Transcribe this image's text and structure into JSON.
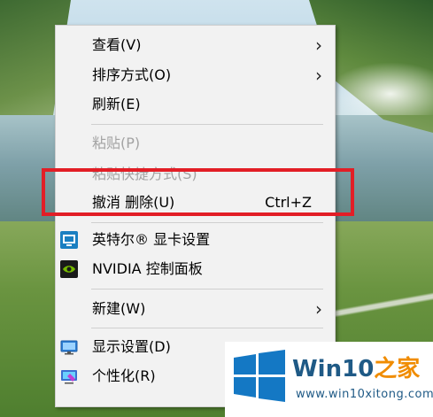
{
  "context_menu": {
    "items": [
      {
        "label": "查看(V)",
        "has_submenu": true,
        "enabled": true
      },
      {
        "label": "排序方式(O)",
        "has_submenu": true,
        "enabled": true
      },
      {
        "label": "刷新(E)",
        "enabled": true
      },
      {
        "label": "粘贴(P)",
        "enabled": false
      },
      {
        "label": "粘贴快捷方式(S)",
        "enabled": false
      },
      {
        "label": "撤消 删除(U)",
        "shortcut": "Ctrl+Z",
        "enabled": true
      },
      {
        "label": "英特尔® 显卡设置",
        "icon": "intel-graphics-icon",
        "enabled": true
      },
      {
        "label": "NVIDIA 控制面板",
        "icon": "nvidia-icon",
        "enabled": true
      },
      {
        "label": "新建(W)",
        "has_submenu": true,
        "enabled": true
      },
      {
        "label": "显示设置(D)",
        "icon": "display-settings-icon",
        "enabled": true
      },
      {
        "label": "个性化(R)",
        "icon": "personalize-icon",
        "enabled": true
      }
    ],
    "submenu_arrow": "›"
  },
  "highlight": {
    "color": "#e21e26"
  },
  "watermark": {
    "title_main": "Win10",
    "title_accent": "之家",
    "url": "www.win10xitong.com"
  }
}
